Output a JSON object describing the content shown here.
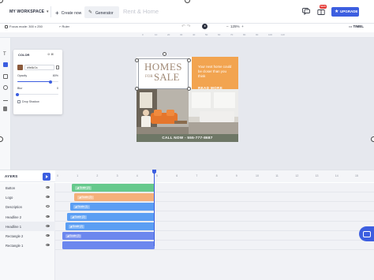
{
  "topbar": {
    "workspace": "MY WORKSPACE",
    "create_now": "Create now",
    "generator": "Generator",
    "doc_title": "Rent & Home",
    "badge": "NEW",
    "upgrade": "UPGRADE"
  },
  "toolbar": {
    "focus_mode": "Focus mode: 300 x 250",
    "ruler": "Ruler",
    "zoom": "125%",
    "timeline": "TIMEL"
  },
  "ruler": {
    "ticks": [
      "0",
      "10",
      "20",
      "30",
      "40",
      "50",
      "60",
      "70",
      "80",
      "90",
      "100",
      "110"
    ]
  },
  "color_panel": {
    "title": "COLOR",
    "hex": "#9e8c7a",
    "opacity_label": "Opacity",
    "opacity_value": "80%",
    "opacity_fraction": 0.8,
    "blur_label": "Blur",
    "blur_value": "0",
    "blur_fraction": 0.0,
    "drop_shadow": "Drop Shadow"
  },
  "artboard": {
    "logo_line1": "HOMES",
    "logo_for": "FOR",
    "logo_line2": "SALE",
    "tagline": "Your next home could be closer than you think",
    "cta": "READ MORE",
    "footer": "CALL NOW - 555-777-8687"
  },
  "timeline": {
    "title": "AYERS",
    "ticks": [
      "0",
      "1",
      "2",
      "3",
      "4",
      "5",
      "6",
      "7",
      "8",
      "9",
      "10",
      "11",
      "12",
      "13",
      "14",
      "15"
    ],
    "layers": [
      {
        "name": "Button",
        "bar_label": "Scale (2)",
        "color": "#66c98c",
        "start": 0.85,
        "end": 5.0
      },
      {
        "name": "Logo",
        "bar_label": "Scale (2)",
        "color": "#f4b07a",
        "start": 0.95,
        "end": 5.0
      },
      {
        "name": "Description",
        "bar_label": "Scale (1)",
        "color": "#5b9ef3",
        "start": 0.75,
        "end": 5.0
      },
      {
        "name": "Headline 2",
        "bar_label": "Scale (2)",
        "color": "#5b9ef3",
        "start": 0.6,
        "end": 5.0
      },
      {
        "name": "Headline 1",
        "bar_label": "Scale (2)",
        "color": "#5b9ef3",
        "start": 0.5,
        "end": 5.0
      },
      {
        "name": "Rectangle 2",
        "bar_label": "Scale (2)",
        "color": "#6c87ee",
        "start": 0.35,
        "end": 5.0
      },
      {
        "name": "Rectangle 1",
        "bar_label": "",
        "color": "#6c87ee",
        "start": 0.35,
        "end": 5.0
      }
    ]
  },
  "colors": {
    "accent": "#3c5ee0",
    "orange_panel": "#f2a450",
    "footer_green": "#6e7766",
    "logo_brown": "#a08975"
  }
}
